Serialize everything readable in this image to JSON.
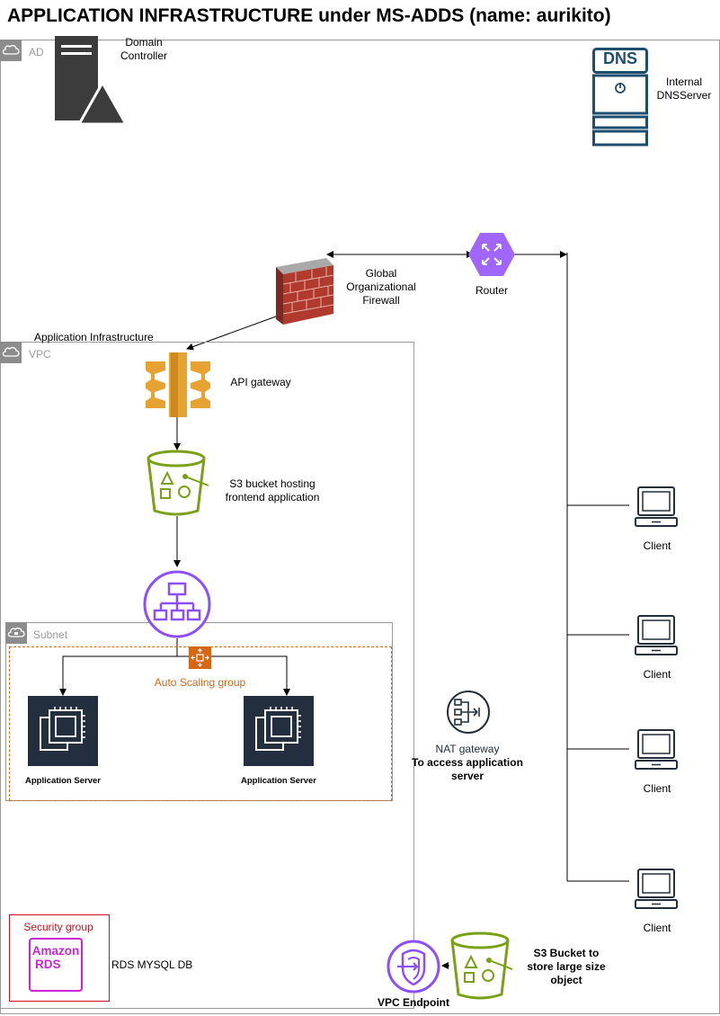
{
  "title": "APPLICATION INFRASTRUCTURE under MS-ADDS (name: aurikito)",
  "groups": {
    "ad": "AD",
    "vpc": "VPC",
    "vpc_caption": "Application Infrastructure",
    "subnet": "Subnet",
    "autoscaling": "Auto Scaling group",
    "security": "Security group"
  },
  "nodes": {
    "domain_controller": "Domain Controller",
    "dns_badge": "DNS",
    "dns_server": "Internal DNSServer",
    "firewall": "Global Organizational Firewall",
    "router": "Router",
    "api_gateway": "API gateway",
    "s3_frontend": "S3 bucket hosting frontend application",
    "app_server_1": "Application Server",
    "app_server_2": "Application Server",
    "nat_gateway": "NAT gateway",
    "nat_note": "To access application server",
    "rds_badge_top": "Amazon",
    "rds_badge_bottom": "RDS",
    "rds": "RDS MYSQL DB",
    "vpc_endpoint": "VPC Endpoint",
    "s3_large": "S3 Bucket to store large size object"
  },
  "clients": [
    "Client",
    "Client",
    "Client",
    "Client"
  ],
  "colors": {
    "group_border": "#9a9a9a",
    "autoscaling": "#d86613",
    "security_group": "#c7131f",
    "s3": "#7aa116",
    "elb": "#8c4fff",
    "api_gateway": "#e7a332",
    "router": "#a166ff",
    "ec2_bg": "#232f3e",
    "dns": "#1e4e6e",
    "rds": "#c925d1",
    "firewall": "#b03a2e"
  },
  "icons": {
    "domain_controller": "server-warning-icon",
    "dns": "dns-server-icon",
    "firewall": "brick-firewall-icon",
    "router": "router-icon",
    "api_gateway": "api-gateway-icon",
    "s3": "s3-bucket-icon",
    "elb": "load-balancer-icon",
    "ec2": "ec2-instance-icon",
    "nat": "nat-gateway-icon",
    "rds": "rds-icon",
    "vpc_endpoint": "vpc-endpoint-icon",
    "client": "client-computer-icon",
    "autoscaling": "autoscaling-icon"
  }
}
